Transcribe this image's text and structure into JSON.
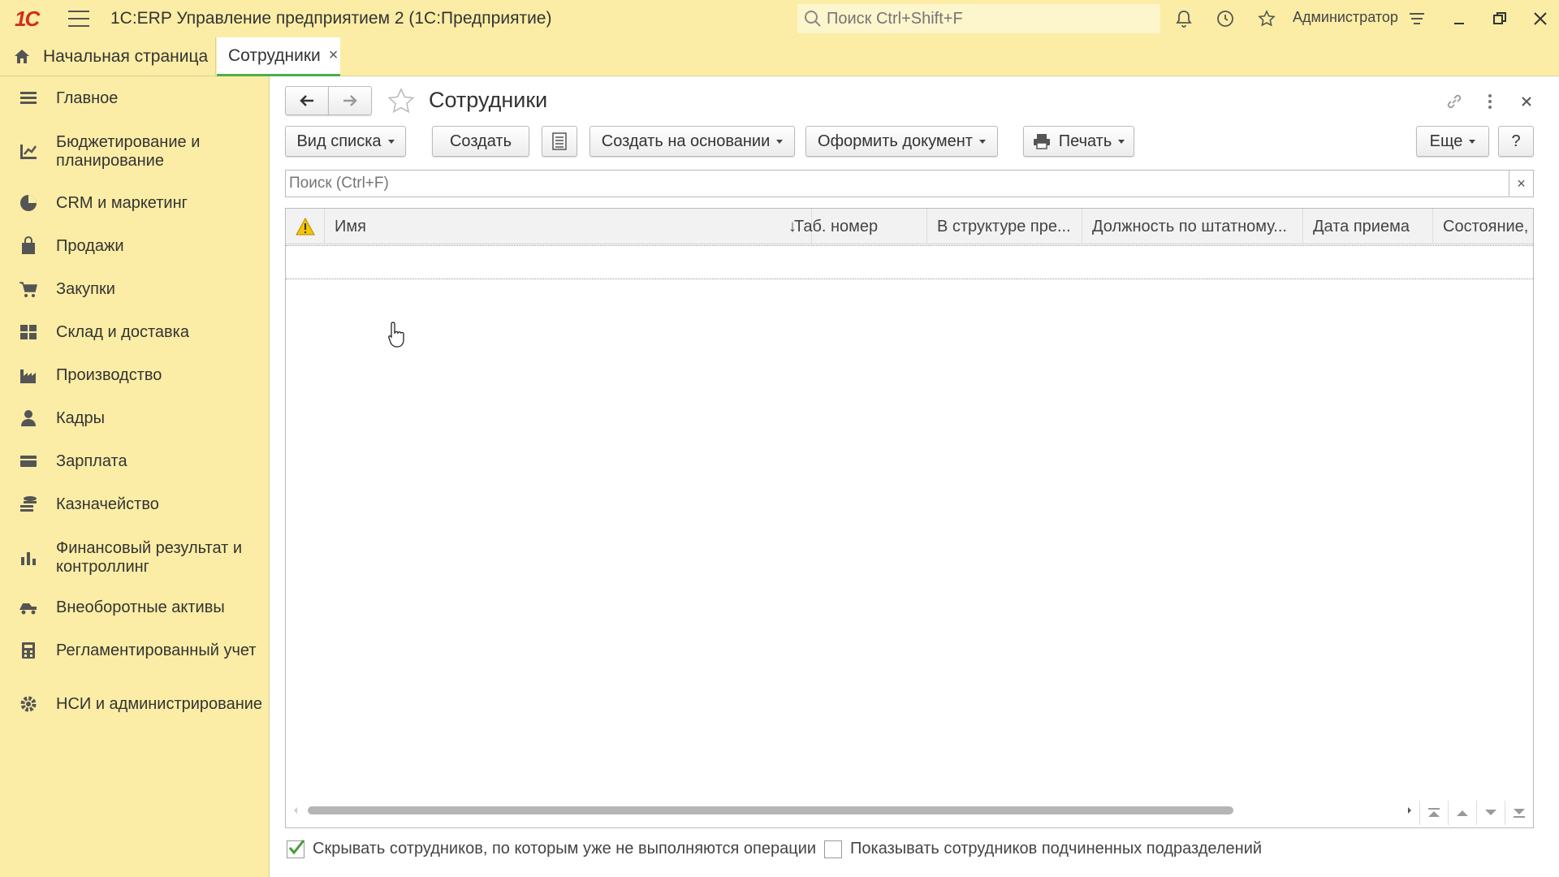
{
  "titlebar": {
    "logo": "1С",
    "app_title": "1С:ERP Управление предприятием 2  (1С:Предприятие)",
    "search_placeholder": "Поиск Ctrl+Shift+F",
    "user": "Администратор"
  },
  "tabs": {
    "home": "Начальная страница",
    "active": "Сотрудники",
    "close_glyph": "×"
  },
  "sidebar": {
    "items": [
      {
        "label": "Главное",
        "icon": "list-icon"
      },
      {
        "label": "Бюджетирование и планирование",
        "icon": "budget-icon"
      },
      {
        "label": "CRM и маркетинг",
        "icon": "pie-icon"
      },
      {
        "label": "Продажи",
        "icon": "bag-icon"
      },
      {
        "label": "Закупки",
        "icon": "cart-icon"
      },
      {
        "label": "Склад и доставка",
        "icon": "warehouse-icon"
      },
      {
        "label": "Производство",
        "icon": "factory-icon"
      },
      {
        "label": "Кадры",
        "icon": "person-icon"
      },
      {
        "label": "Зарплата",
        "icon": "wallet-icon"
      },
      {
        "label": "Казначейство",
        "icon": "coins-icon"
      },
      {
        "label": "Финансовый результат и контроллинг",
        "icon": "chart-icon"
      },
      {
        "label": "Внеоборотные активы",
        "icon": "truck-icon"
      },
      {
        "label": "Регламентированный учет",
        "icon": "calculator-icon"
      },
      {
        "label": "НСИ и администрирование",
        "icon": "gear-icon"
      }
    ]
  },
  "form": {
    "title": "Сотрудники",
    "toolbar": {
      "list_view": "Вид списка",
      "create": "Создать",
      "create_based_on": "Создать на основании",
      "make_document": "Оформить документ",
      "print": "Печать",
      "more": "Еще",
      "help": "?"
    },
    "search_placeholder": "Поиск (Ctrl+F)",
    "search_clear": "×",
    "columns": [
      "Имя",
      "Таб. номер",
      "В структуре пре...",
      "Должность по штатному...",
      "Дата приема",
      "Состояние, да"
    ],
    "sort_glyph": "↓",
    "rows": [],
    "footer": {
      "hide_inactive": {
        "label": "Скрывать сотрудников, по которым уже не выполняются операции",
        "checked": true
      },
      "show_subordinate": {
        "label": "Показывать сотрудников подчиненных подразделений",
        "checked": false
      }
    }
  },
  "colors": {
    "panel": "#fbeda5",
    "accent_tab": "#4cae4c",
    "logo": "#d52b1e"
  }
}
